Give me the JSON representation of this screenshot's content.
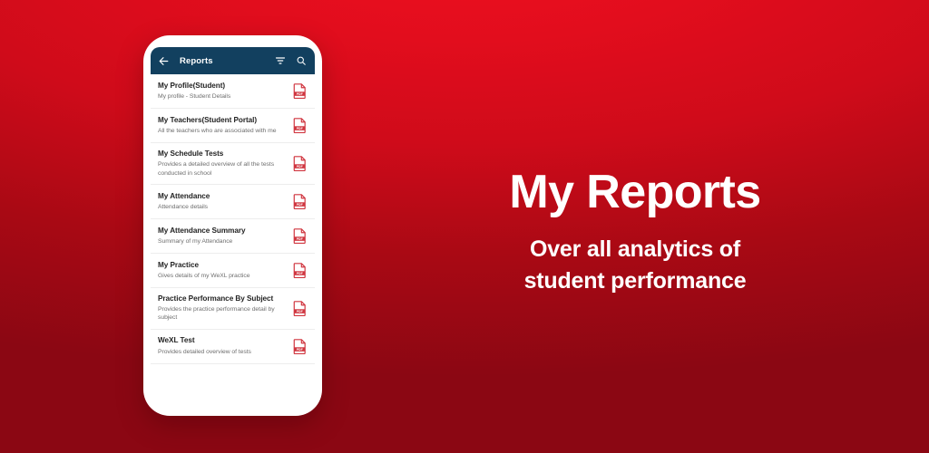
{
  "background": {
    "color_top": "#ef0f20",
    "color_bottom": "#8b0713"
  },
  "phone": {
    "appbar": {
      "back_icon": "arrow-left-icon",
      "title": "Reports",
      "filter_icon": "filter-icon",
      "search_icon": "search-icon",
      "background_color": "#12405f"
    },
    "list": {
      "item_icon": "pdf-file-icon",
      "item_icon_color": "#d0353f",
      "items": [
        {
          "title": "My Profile(Student)",
          "subtitle": "My profile - Student Details"
        },
        {
          "title": "My Teachers(Student Portal)",
          "subtitle": "All the teachers who are associated with me"
        },
        {
          "title": "My Schedule Tests",
          "subtitle": "Provides a detailed overview of all the tests conducted in school"
        },
        {
          "title": "My Attendance",
          "subtitle": "Attendance details"
        },
        {
          "title": "My Attendance Summary",
          "subtitle": "Summary of my Attendance"
        },
        {
          "title": "My Practice",
          "subtitle": "Gives details of my WeXL practice"
        },
        {
          "title": "Practice Performance By Subject",
          "subtitle": "Provides the practice performance detail by subject"
        },
        {
          "title": "WeXL Test",
          "subtitle": "Provides detailed overview of tests"
        }
      ]
    }
  },
  "hero": {
    "title": "My Reports",
    "subtitle_line1": "Over all analytics of",
    "subtitle_line2": "student performance"
  }
}
